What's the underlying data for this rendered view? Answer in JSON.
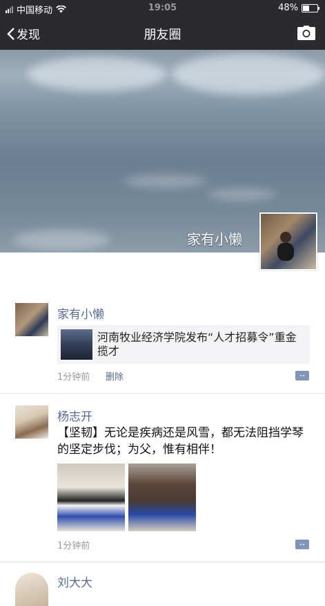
{
  "status_bar": {
    "carrier": "中国移动",
    "time": "19:05",
    "battery": "48%"
  },
  "nav": {
    "back_label": "发现",
    "title": "朋友圈"
  },
  "cover": {
    "name": "家有小懒"
  },
  "posts": [
    {
      "name": "家有小懒",
      "share_title": "河南牧业经济学院发布“人才招募令”重金揽才",
      "time": "1分钟前",
      "delete_label": "删除"
    },
    {
      "name": "杨志开",
      "text": "【坚韧】无论是疾病还是风雪，都无法阻挡学琴的坚定步伐；为父，惟有相伴！",
      "time": "1分钟前"
    },
    {
      "name": "刘大大"
    }
  ],
  "icons": {
    "back": "chevron-left-icon",
    "camera": "camera-icon",
    "comment": "comment-icon",
    "wifi": "wifi-icon",
    "battery": "battery-icon",
    "signal": "signal-icon"
  },
  "colors": {
    "bar": "#2b2b2f",
    "link": "#576b95",
    "share_bg": "#f3f3f5",
    "time": "#9a9a9a"
  }
}
